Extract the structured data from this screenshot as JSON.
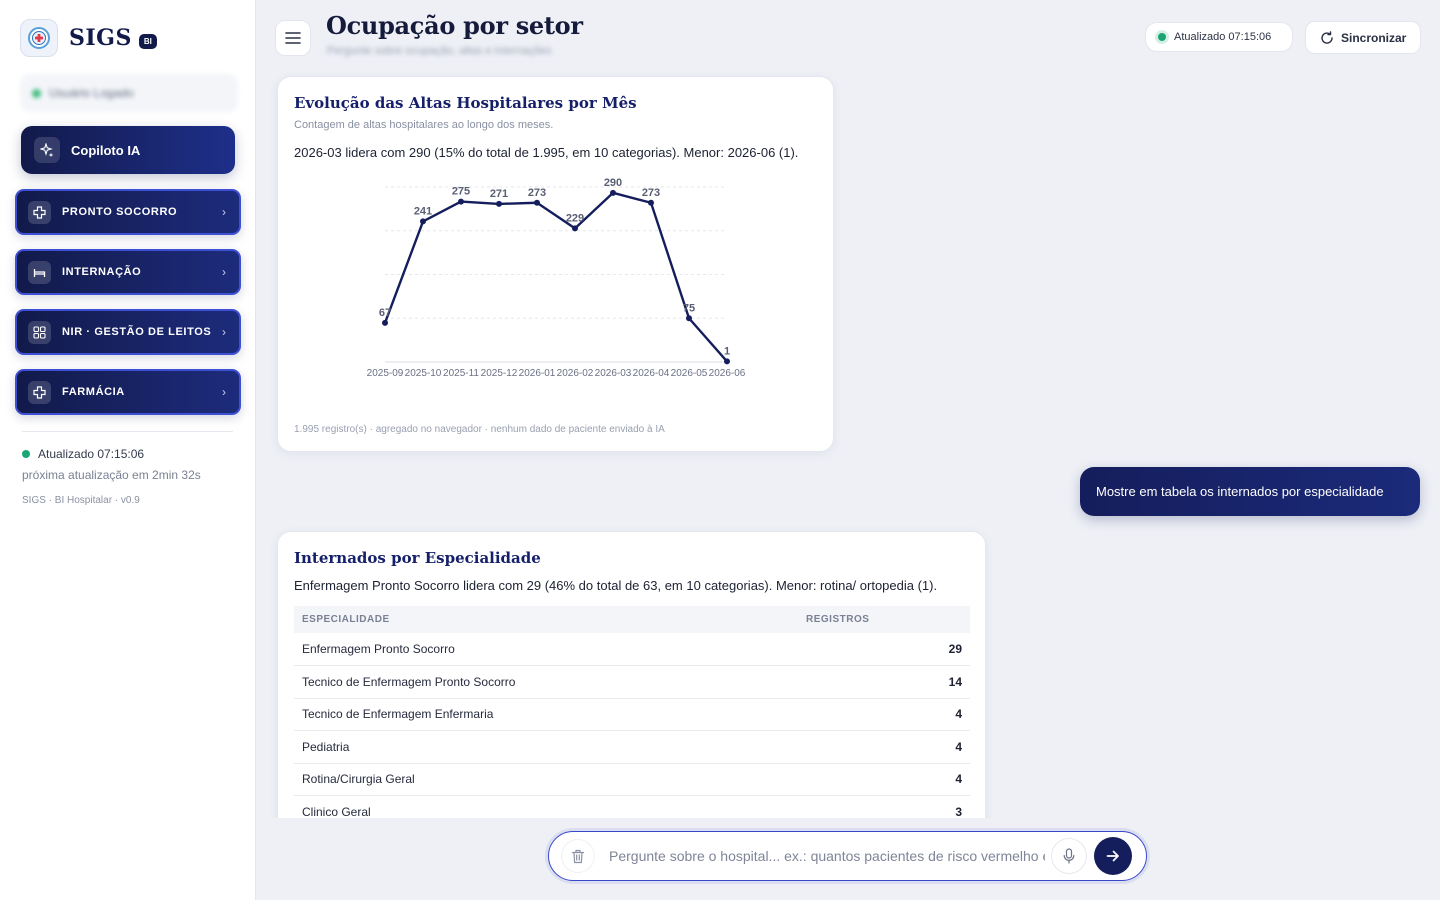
{
  "brand": {
    "name": "SIGS",
    "badge": "BI"
  },
  "sidebar": {
    "user_name": "Usuário Logado",
    "copilot_label": "Copiloto IA",
    "items": [
      {
        "label": "PRONTO SOCORRO",
        "icon": "plus-cross-icon"
      },
      {
        "label": "INTERNAÇÃO",
        "icon": "bed-icon"
      },
      {
        "label": "NIR · GESTÃO DE LEITOS",
        "icon": "grid-icon"
      },
      {
        "label": "FARMÁCIA",
        "icon": "plus-cross-icon"
      }
    ],
    "status": "Atualizado 07:15:06",
    "next_update": "próxima atualização em 2min 32s",
    "version": "SIGS · BI Hospitalar · v0.9"
  },
  "header": {
    "title": "Ocupação por setor",
    "subtitle": "Pergunte sobre ocupação, altas e internações",
    "updated": "Atualizado 07:15:06",
    "sync_label": "Sincronizar"
  },
  "card1": {
    "title": "Evolução das Altas Hospitalares por Mês",
    "subtitle": "Contagem de altas hospitalares ao longo dos meses.",
    "insight": "2026-03 lidera com 290 (15% do total de 1.995, em 10 categorias). Menor: 2026-06 (1).",
    "footer": "1.995 registro(s) · agregado no navegador · nenhum dado de paciente enviado à IA"
  },
  "chart_data": {
    "type": "line",
    "title": "Evolução das Altas Hospitalares por Mês",
    "categories": [
      "2025-09",
      "2025-10",
      "2025-11",
      "2025-12",
      "2026-01",
      "2026-02",
      "2026-03",
      "2026-04",
      "2026-05",
      "2026-06"
    ],
    "values": [
      67,
      241,
      275,
      271,
      273,
      229,
      290,
      273,
      75,
      1
    ],
    "ylim": [
      0,
      300
    ],
    "grid": true,
    "color": "#151e5c"
  },
  "user_message": "Mostre em tabela os internados por especialidade",
  "card2": {
    "title": "Internados por Especialidade",
    "insight": "Enfermagem Pronto Socorro lidera com 29 (46% do total de 63, em 10 categorias). Menor: rotina/ ortopedia (1).",
    "columns": [
      "ESPECIALIDADE",
      "REGISTROS"
    ],
    "rows": [
      {
        "name": "Enfermagem Pronto Socorro",
        "value": "29"
      },
      {
        "name": "Tecnico de Enfermagem Pronto Socorro",
        "value": "14"
      },
      {
        "name": "Tecnico de Enfermagem Enfermaria",
        "value": "4"
      },
      {
        "name": "Pediatria",
        "value": "4"
      },
      {
        "name": "Rotina/Cirurgia Geral",
        "value": "4"
      },
      {
        "name": "Clinico Geral",
        "value": "3"
      }
    ]
  },
  "composer": {
    "placeholder": "Pergunte sobre o hospital... ex.: quantos pacientes de risco vermelho estão no PS?"
  }
}
